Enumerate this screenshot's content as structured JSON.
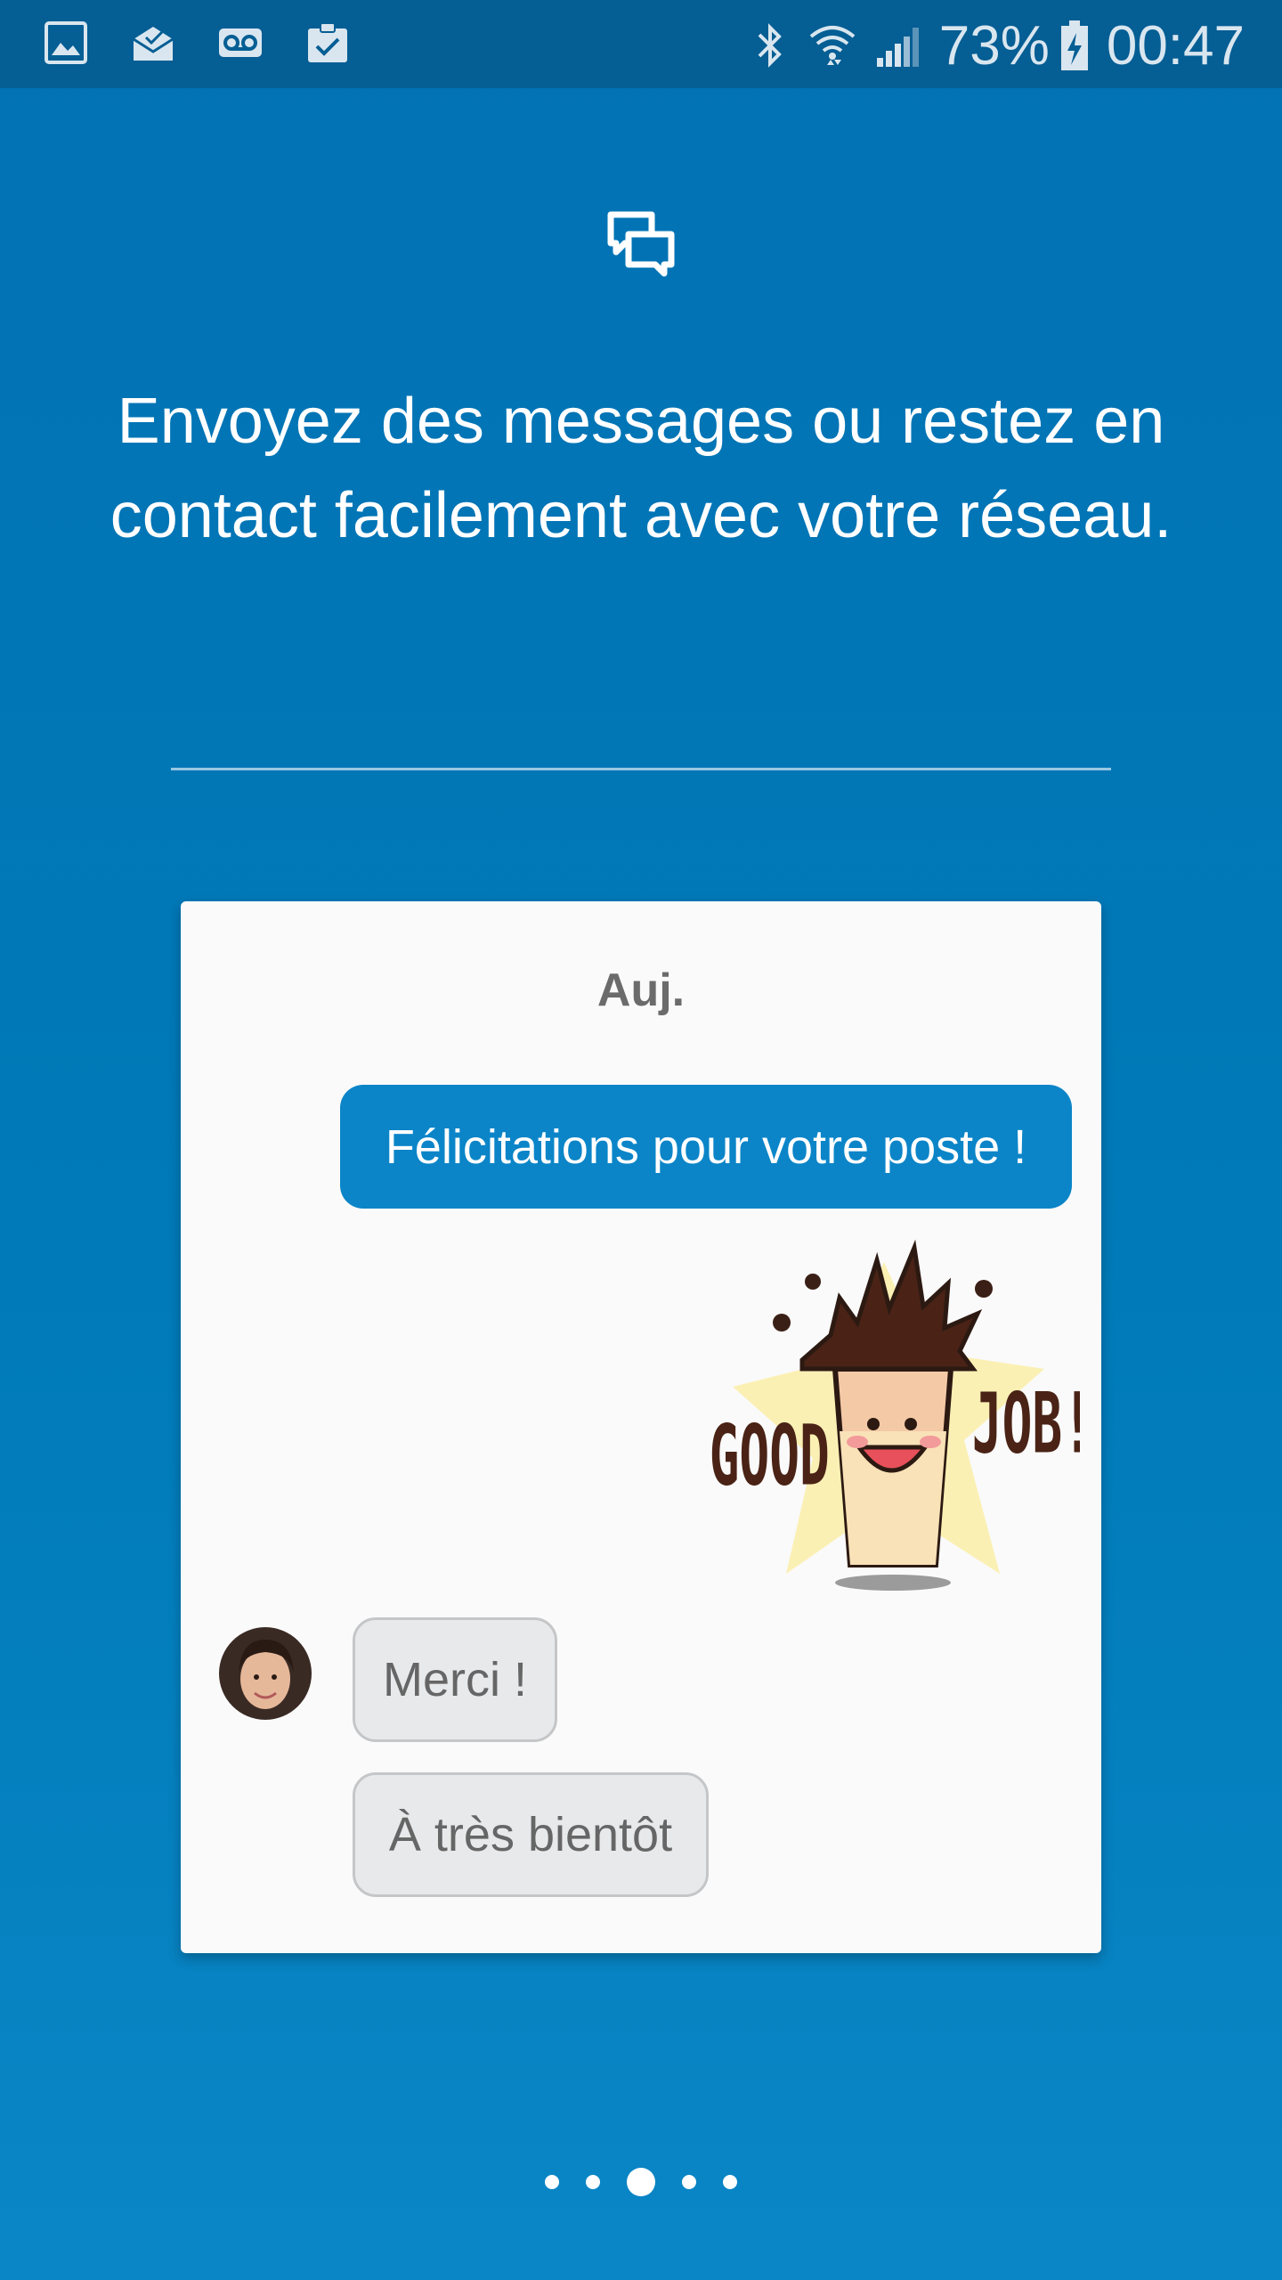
{
  "status_bar": {
    "left_icons": [
      "gallery-icon",
      "email-icon",
      "voicemail-icon",
      "clipboard-check-icon"
    ],
    "right_icons": [
      "bluetooth-icon",
      "wifi-icon",
      "signal-icon"
    ],
    "battery_percent": "73%",
    "battery_icon": "battery-charging-icon",
    "time": "00:47"
  },
  "onboarding": {
    "icon": "chat-bubbles-icon",
    "headline": "Envoyez des messages ou restez en contact facilement avec votre réseau."
  },
  "conversation": {
    "date_label": "Auj.",
    "outgoing_message": "Félicitations pour votre poste !",
    "sticker_text": [
      "GOOD",
      "JOB!"
    ],
    "incoming_messages": [
      "Merci !",
      "À très bientôt"
    ]
  },
  "pager": {
    "page_count": 5,
    "active_page": 3
  },
  "colors": {
    "background": "#0272b4",
    "status_bar": "#055e94",
    "outgoing_bubble": "#0b85c8",
    "incoming_bubble": "#e8e9ea",
    "card": "#fafafa"
  }
}
